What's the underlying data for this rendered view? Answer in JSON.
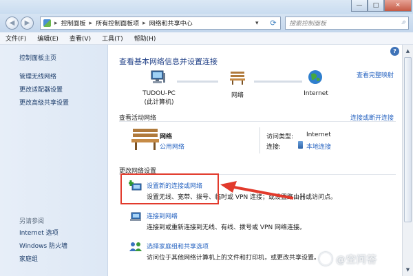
{
  "window": {
    "minimize": "—",
    "maximize": "□",
    "close": "✕"
  },
  "address": {
    "segments": [
      "控制面板",
      "所有控制面板项",
      "网络和共享中心"
    ],
    "search_placeholder": "搜索控制面板"
  },
  "menu": [
    "文件(F)",
    "编辑(E)",
    "查看(V)",
    "工具(T)",
    "帮助(H)"
  ],
  "sidebar": {
    "home": "控制面板主页",
    "links": [
      "管理无线网络",
      "更改适配器设置",
      "更改高级共享设置"
    ],
    "see_also_title": "另请参阅",
    "see_also": [
      "Internet 选项",
      "Windows 防火墙",
      "家庭组"
    ]
  },
  "main": {
    "title": "查看基本网络信息并设置连接",
    "view_full_map": "查看完整映射",
    "map": {
      "computer": "TUDOU-PC",
      "computer_sub": "(此计算机)",
      "network": "网络",
      "internet": "Internet"
    },
    "active_title": "查看活动网络",
    "connect_disconnect": "连接或断开连接",
    "network_name": "网络",
    "network_type": "公用网络",
    "access_type_label": "访问类型:",
    "access_type_value": "Internet",
    "connection_label": "连接:",
    "connection_value": "本地连接",
    "change_title": "更改网络设置",
    "tasks": [
      {
        "title": "设置新的连接或网络",
        "desc": "设置无线、宽带、拨号、临时或 VPN 连接；或设置路由器或访问点。"
      },
      {
        "title": "连接到网络",
        "desc": "连接到或重新连接到无线、有线、拨号或 VPN 网络连接。"
      },
      {
        "title": "选择家庭组和共享选项",
        "desc": "访问位于其他网络计算机上的文件和打印机，或更改共享设置。"
      }
    ]
  },
  "watermark": "@空问答"
}
